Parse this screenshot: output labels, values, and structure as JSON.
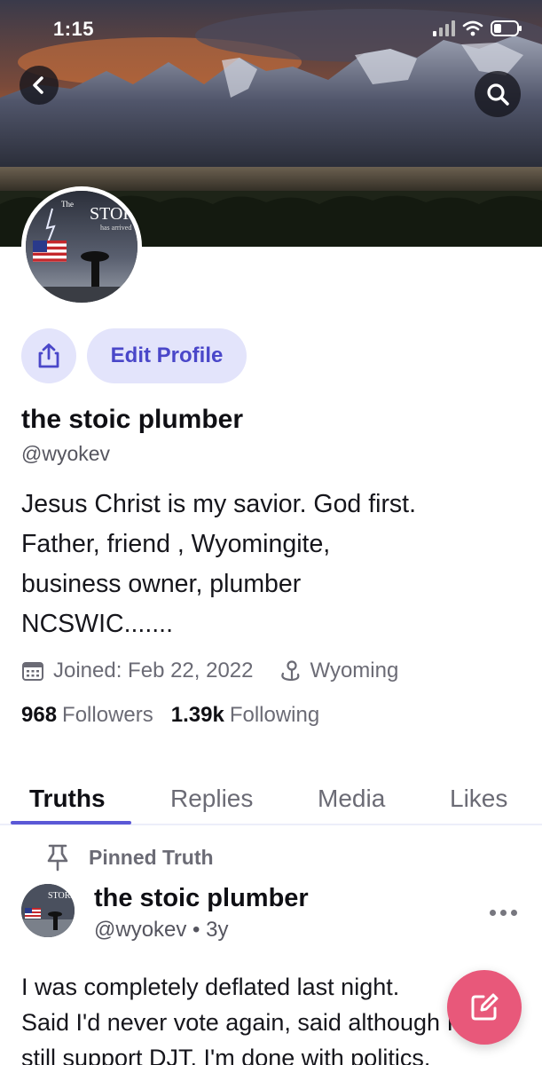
{
  "status_bar": {
    "time": "1:15"
  },
  "banner": {
    "avatar_text_the": "The",
    "avatar_text_storm": "STORM",
    "avatar_text_arrived": "has arrived"
  },
  "actions": {
    "edit_profile": "Edit Profile"
  },
  "profile": {
    "display_name": "the stoic plumber",
    "handle": "@wyokev",
    "bio_lines": [
      "Jesus Christ is my savior. God first.",
      "Father, friend , Wyomingite,",
      "business owner, plumber",
      "NCSWIC......."
    ],
    "joined": "Joined: Feb 22, 2022",
    "location": "Wyoming",
    "followers_count": "968",
    "followers_label": "Followers",
    "following_count": "1.39k",
    "following_label": "Following"
  },
  "tabs": [
    {
      "label": "Truths",
      "active": true
    },
    {
      "label": "Replies",
      "active": false
    },
    {
      "label": "Media",
      "active": false
    },
    {
      "label": "Likes",
      "active": false
    }
  ],
  "pinned_post": {
    "pinned_label": "Pinned Truth",
    "author_name": "the stoic plumber",
    "author_meta": "@wyokev • 3y",
    "text_lines": [
      "I was completely deflated last night.",
      "Said I'd never vote again, said although I",
      "still support DJT, I'm done with politics."
    ]
  },
  "icons": {
    "back": "chevron-left-icon",
    "search": "search-icon",
    "share": "share-icon",
    "calendar": "calendar-icon",
    "location": "map-pin-icon",
    "pin": "pin-icon",
    "more": "more-horizontal-icon",
    "compose": "compose-icon"
  },
  "colors": {
    "accent": "#5b58d6",
    "accent_bg": "#e3e4fb",
    "fab": "#e8587a"
  }
}
